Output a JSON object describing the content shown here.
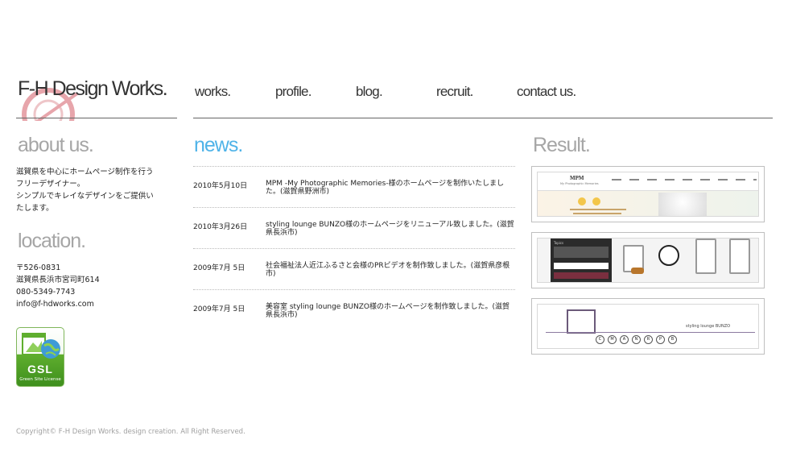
{
  "header": {
    "logo_text": "F-H Design Works."
  },
  "nav": {
    "items": [
      "works.",
      "profile.",
      "blog.",
      "recruit.",
      "contact us."
    ]
  },
  "about": {
    "title": "about us.",
    "lines": [
      "滋賀県を中心にホームページ制作を行う",
      "フリーデザイナー。",
      "シンプルでキレイなデザインをご提供い",
      "たします。"
    ]
  },
  "location": {
    "title": "location.",
    "lines": [
      "〒526-0831",
      "滋賀県長浜市宮司町614",
      "080-5349-7743",
      "info@f-hdworks.com"
    ]
  },
  "badge": {
    "main": "GSL",
    "sub": "Green Site License"
  },
  "news": {
    "title": "news.",
    "items": [
      {
        "date": "2010年5月10日",
        "text": "MPM -My Photographic Memories-様のホームページを制作いたしました。(滋賀県野洲市)"
      },
      {
        "date": "2010年3月26日",
        "text": "styling lounge BUNZO様のホームページをリニューアル致しました。(滋賀県長浜市)"
      },
      {
        "date": "2009年7月 5日",
        "text": "社会福祉法人近江ふるさと会様のPRビデオを制作致しました。(滋賀県彦根市)"
      },
      {
        "date": "2009年7月 5日",
        "text": "美容室 styling lounge BUNZO様のホームページを制作致しました。(滋賀県長浜市)"
      }
    ]
  },
  "result": {
    "title": "Result.",
    "thumbs": [
      {
        "label": "MPM",
        "sub": "My Photographic Memories"
      },
      {
        "label": "Topics"
      },
      {
        "label": "styling lounge BUNZO",
        "letters": [
          "C",
          "M",
          "A",
          "N",
          "R",
          "P",
          "B"
        ]
      }
    ]
  },
  "footer": {
    "copyright": "Copyright© F-H Design Works. design creation. All Right Reserved."
  },
  "colors": {
    "accent_blue": "#4fb3e8",
    "logo_mark": "#e7a5ab",
    "heading_gray": "#a6a6a6",
    "badge_green": "#4a9a24"
  }
}
